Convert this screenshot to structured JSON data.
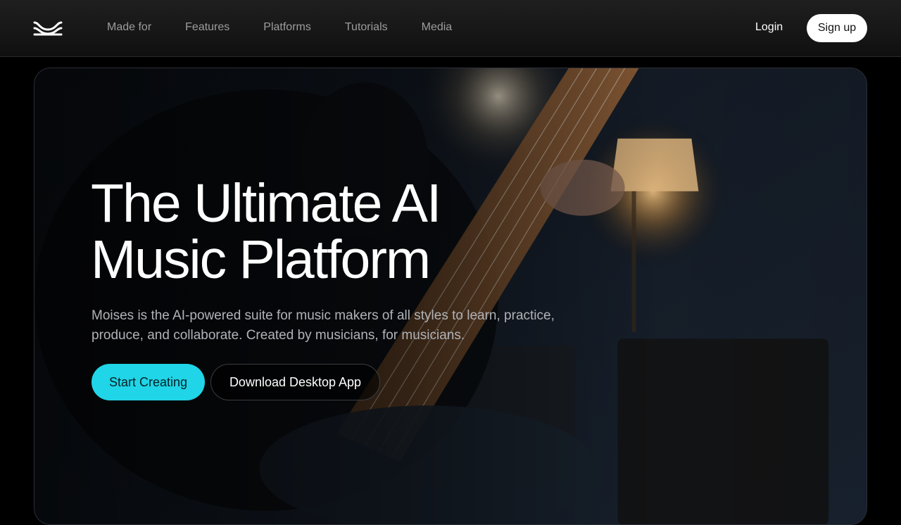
{
  "nav": {
    "logo_icon": "moises-wave-logo-icon",
    "links": [
      "Made for",
      "Features",
      "Platforms",
      "Tutorials",
      "Media"
    ],
    "login_label": "Login",
    "signup_label": "Sign up"
  },
  "hero": {
    "title_line1": "The Ultimate AI",
    "title_line2": "Music Platform",
    "subtitle_line1": "Moises is the AI-powered suite for music makers of all styles to learn, practice,",
    "subtitle_line2": "produce, and collaborate. Created by musicians, for musicians.",
    "primary_cta": "Start Creating",
    "secondary_cta": "Download Desktop App",
    "background_image": "guitarist-playing-electric-guitar-in-dim-room-photo"
  },
  "colors": {
    "accent": "#1fd5e7",
    "background": "#000000",
    "nav_text": "#9d9d9d"
  }
}
